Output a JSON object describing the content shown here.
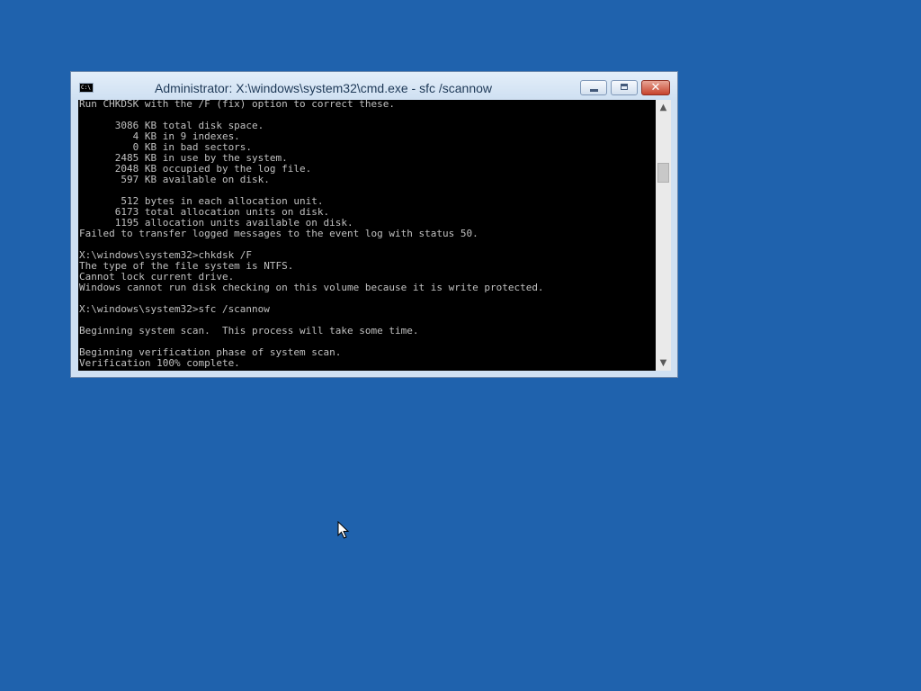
{
  "window": {
    "title": "Administrator: X:\\windows\\system32\\cmd.exe - sfc  /scannow",
    "app_icon_label": "C:\\",
    "controls": {
      "minimize": "minimize",
      "maximize": "maximize",
      "close": "✕"
    }
  },
  "console": {
    "lines": [
      "Run CHKDSK with the /F (fix) option to correct these.",
      "",
      "      3086 KB total disk space.",
      "         4 KB in 9 indexes.",
      "         0 KB in bad sectors.",
      "      2485 KB in use by the system.",
      "      2048 KB occupied by the log file.",
      "       597 KB available on disk.",
      "",
      "       512 bytes in each allocation unit.",
      "      6173 total allocation units on disk.",
      "      1195 allocation units available on disk.",
      "Failed to transfer logged messages to the event log with status 50.",
      "",
      "X:\\windows\\system32>chkdsk /F",
      "The type of the file system is NTFS.",
      "Cannot lock current drive.",
      "Windows cannot run disk checking on this volume because it is write protected.",
      "",
      "X:\\windows\\system32>sfc /scannow",
      "",
      "Beginning system scan.  This process will take some time.",
      "",
      "Beginning verification phase of system scan.",
      "Verification 100% complete."
    ]
  },
  "scrollbar": {
    "up_arrow": "▲",
    "down_arrow": "▼"
  },
  "colors": {
    "desktop_background": "#1f62ad",
    "console_background": "#000000",
    "console_text": "#c0c0c0"
  }
}
